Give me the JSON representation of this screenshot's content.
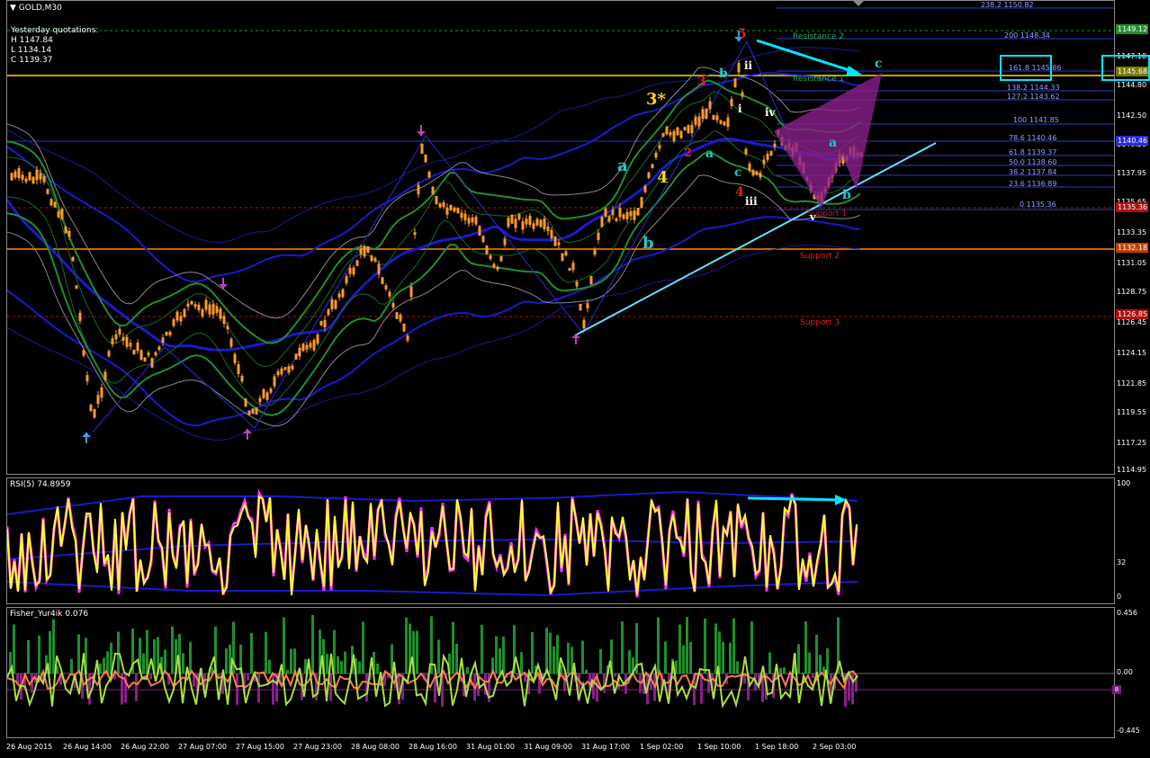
{
  "chart": {
    "symbol_label": "GOLD,M30",
    "info": {
      "heading": "Yesterday quotations:",
      "high": "H 1147.84",
      "low": "L 1134.14",
      "close": "C 1139.37"
    },
    "price_axis": [
      "1149.12",
      "1147.10",
      "1144.80",
      "1142.50",
      "1140.20",
      "1137.95",
      "1135.65",
      "1133.35",
      "1131.05",
      "1128.75",
      "1126.45",
      "1124.15",
      "1121.85",
      "1119.55",
      "1117.25",
      "1114.95"
    ],
    "price_tags": [
      {
        "label": "1149.12",
        "color": "#1f8f2c"
      },
      {
        "label": "1145.68",
        "color": "#7a7a00"
      },
      {
        "label": "1140.46",
        "color": "#2b2bd9"
      },
      {
        "label": "1135.36",
        "color": "#b01010"
      },
      {
        "label": "1132.18",
        "color": "#c04000"
      },
      {
        "label": "1126.85",
        "color": "#b01010"
      }
    ],
    "levels": {
      "resistance2": "Resistance 2",
      "resistance1": "Resistance 1",
      "support1": "Support 1",
      "support2": "Support 2",
      "support3": "Support 3"
    },
    "fib_labels": [
      "238.2 1150.82",
      "200 1148.34",
      "161.8 1145.86",
      "138.2 1144.33",
      "127.2 1143.62",
      "100 1141.85",
      "78.6 1140.46",
      "61.8 1139.37",
      "50.0 1138.60",
      "38.2 1137.84",
      "23.6 1136.89",
      "0 1135.36"
    ],
    "waves": {
      "w5": "5",
      "w3star": "3*",
      "w3": "3",
      "w4y": "4",
      "w2": "2",
      "w4r": "4",
      "a1": "a",
      "b1": "b",
      "a2": "a",
      "b2": "b",
      "c1": "c",
      "c2": "c",
      "r_i": "i",
      "r_ii": "ii",
      "r_iii": "iii",
      "r_iv": "iv",
      "r_v": "v",
      "a3": "a",
      "b3": "b"
    },
    "colors": {
      "candle": "#ff9a2e",
      "bollinger": "#1a1acc",
      "envelope": "#1f8f2c",
      "trendline": "#66e0ff",
      "pattern": "#8a1f8a"
    }
  },
  "rsi": {
    "label": "RSI(5) 74.8959",
    "axis": [
      "100",
      "32",
      "0"
    ]
  },
  "fisher": {
    "label": "Fisher_Yur4ik 0.076",
    "axis": [
      "0.456",
      "0.00",
      "-0.445"
    ]
  },
  "time_axis": [
    "26 Aug 2015",
    "26 Aug 14:00",
    "26 Aug 22:00",
    "27 Aug 07:00",
    "27 Aug 15:00",
    "27 Aug 23:00",
    "28 Aug 08:00",
    "28 Aug 16:00",
    "31 Aug 01:00",
    "31 Aug 09:00",
    "31 Aug 17:00",
    "1 Sep 02:00",
    "1 Sep 10:00",
    "1 Sep 18:00",
    "2 Sep 03:00"
  ]
}
